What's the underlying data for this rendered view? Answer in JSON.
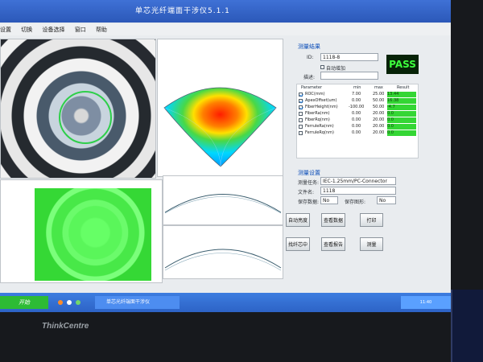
{
  "window": {
    "title": "单芯光纤端面干涉仪5.1.1"
  },
  "menu": {
    "items": [
      "设置",
      "切换",
      "设备选择",
      "窗口",
      "帮助"
    ]
  },
  "measurement": {
    "title": "测量结果",
    "id_label": "ID:",
    "id_value": "1118-8",
    "auto_increment_label": "自动增加",
    "description_label": "描述:",
    "description_value": "",
    "status": "PASS",
    "status_color": "#3dff3d"
  },
  "results_table": {
    "headers": [
      "Parameter",
      "min",
      "max",
      "Result"
    ],
    "rows": [
      {
        "checked": true,
        "parameter": "ROC(mm)",
        "min": "7.00",
        "max": "25.00",
        "result": "13.44"
      },
      {
        "checked": true,
        "parameter": "ApexOffset(um)",
        "min": "0.00",
        "max": "50.00",
        "result": "16.38"
      },
      {
        "checked": true,
        "parameter": "FiberHeight(nm)",
        "min": "-100.00",
        "max": "50.00",
        "result": "-4.7"
      },
      {
        "checked": false,
        "parameter": "FiberRa(nm)",
        "min": "0.00",
        "max": "20.00",
        "result": "0.0"
      },
      {
        "checked": false,
        "parameter": "FiberRq(nm)",
        "min": "0.00",
        "max": "20.00",
        "result": "0.0"
      },
      {
        "checked": false,
        "parameter": "FerruleRa(nm)",
        "min": "0.00",
        "max": "20.00",
        "result": "0.0"
      },
      {
        "checked": false,
        "parameter": "FerruleRq(nm)",
        "min": "0.00",
        "max": "20.00",
        "result": "0.0"
      }
    ]
  },
  "settings": {
    "title": "测量设置",
    "task_label": "测量任务:",
    "task_value": "IEC-1.25mm/PC-Connector",
    "file_label": "文件名:",
    "file_value": "1118",
    "save_label": "保存数据:",
    "save_value": "No",
    "save_pic_label": "保存图形:",
    "save_pic_value": "No"
  },
  "buttons": {
    "auto_brightness": "自动亮度",
    "view_data": "查看数据",
    "print": "打印",
    "find_center": "找纤芯中",
    "view_report": "查看报告",
    "measure": "测量"
  },
  "taskbar": {
    "start": "开始",
    "task": "单芯光纤端面干涉仪",
    "clock": "11:40"
  },
  "branding": {
    "logo": "ThinkCentre"
  },
  "icons": {
    "app": "window-icon",
    "status": "pass-icon",
    "checked": "check-icon"
  }
}
